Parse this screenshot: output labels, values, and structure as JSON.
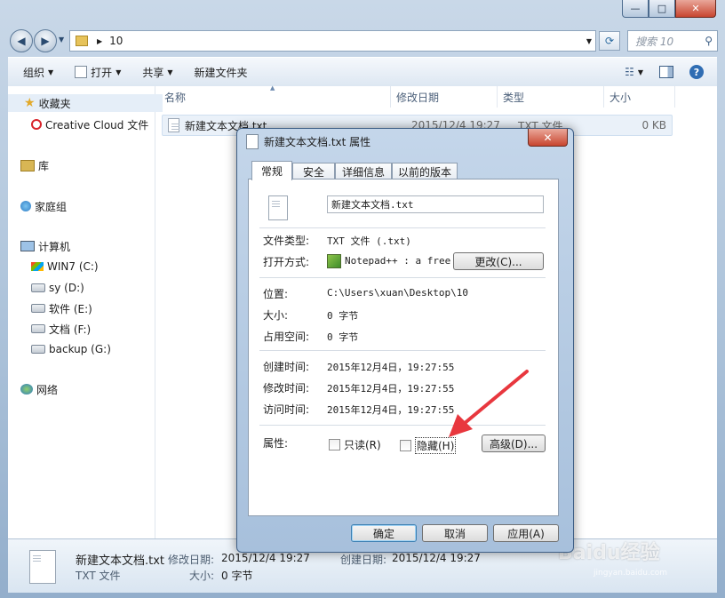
{
  "window": {
    "minimize": "—",
    "maximize": "□",
    "close": "✕"
  },
  "address": {
    "path": "10",
    "search_placeholder": "搜索 10"
  },
  "toolbar": {
    "organize": "组织",
    "open": "打开",
    "share": "共享",
    "new_folder": "新建文件夹"
  },
  "nav": {
    "favorites": "收藏夹",
    "creative_cloud": "Creative Cloud 文件",
    "libraries": "库",
    "homegroup": "家庭组",
    "computer": "计算机",
    "drives": [
      "WIN7 (C:)",
      "sy (D:)",
      "软件 (E:)",
      "文档 (F:)",
      "backup (G:)"
    ],
    "network": "网络"
  },
  "columns": {
    "name": "名称",
    "modified": "修改日期",
    "type": "类型",
    "size": "大小"
  },
  "file_row": {
    "name": "新建文本文档.txt",
    "modified": "2015/12/4 19:27",
    "type": "TXT 文件",
    "size": "0 KB"
  },
  "details": {
    "name": "新建文本文档.txt",
    "type": "TXT 文件",
    "modified_label": "修改日期:",
    "modified_value": "2015/12/4 19:27",
    "created_label": "创建日期:",
    "created_value": "2015/12/4 19:27",
    "size_label": "大小:",
    "size_value": "0 字节"
  },
  "dialog": {
    "title": "新建文本文档.txt 属性",
    "close": "✕",
    "tabs": [
      "常规",
      "安全",
      "详细信息",
      "以前的版本"
    ],
    "filename": "新建文本文档.txt",
    "file_type_label": "文件类型:",
    "file_type_value": "TXT 文件 (.txt)",
    "open_with_label": "打开方式:",
    "open_with_value": "Notepad++ : a free",
    "change_button": "更改(C)...",
    "location_label": "位置:",
    "location_value": "C:\\Users\\xuan\\Desktop\\10",
    "size_label": "大小:",
    "size_value": "0 字节",
    "disk_size_label": "占用空间:",
    "disk_size_value": "0 字节",
    "created_label": "创建时间:",
    "created_value": "2015年12月4日，19:27:55",
    "modified_label": "修改时间:",
    "modified_value": "2015年12月4日，19:27:55",
    "accessed_label": "访问时间:",
    "accessed_value": "2015年12月4日，19:27:55",
    "attributes_label": "属性:",
    "readonly_label": "只读(R)",
    "hidden_label": "隐藏(H)",
    "advanced_button": "高级(D)...",
    "ok_button": "确定",
    "cancel_button": "取消",
    "apply_button": "应用(A)"
  },
  "watermark": {
    "brand": "Baidu经验",
    "url": "jingyan.baidu.com"
  },
  "colors": {
    "arrow": "#e8373e",
    "accent": "#3c7fb1"
  }
}
